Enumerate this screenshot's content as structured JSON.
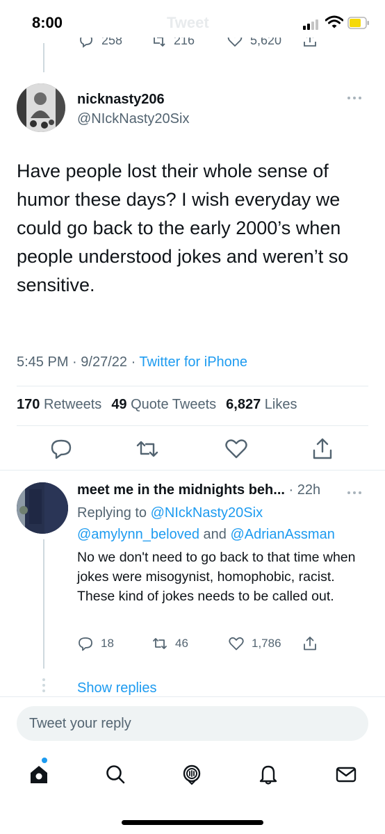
{
  "status_bar": {
    "time": "8:00",
    "faded_title": "Tweet"
  },
  "previous_tweet": {
    "replies": "258",
    "retweets": "216",
    "likes": "5,620"
  },
  "main_tweet": {
    "display_name": "nicknasty206",
    "handle": "@NIckNasty20Six",
    "text": "Have people lost their whole sense of humor these days?  I wish everyday we could go back to the early 2000’s when people understood jokes and weren’t so sensitive.",
    "time": "5:45 PM",
    "date": "9/27/22",
    "source": "Twitter for iPhone",
    "retweets_count": "170",
    "retweets_label": "Retweets",
    "quotes_count": "49",
    "quotes_label": "Quote Tweets",
    "likes_count": "6,827",
    "likes_label": "Likes"
  },
  "reply_tweet": {
    "display_name": "meet me in the midnights beh...",
    "time": "22h",
    "replying_to_label": "Replying to",
    "mention_1": "@NIckNasty20Six",
    "mention_2": "@amylynn_beloved",
    "and_label": "and",
    "mention_3": "@AdrianAssman",
    "text": "No we don't need to go back to that time when jokes were misogynist, homophobic, racist. These kind of jokes needs to be called out.",
    "reply_count": "18",
    "retweet_count": "46",
    "like_count": "1,786",
    "show_replies": "Show replies"
  },
  "composer": {
    "placeholder": "Tweet your reply"
  },
  "colors": {
    "accent": "#1d9bf0",
    "text": "#0f1419",
    "muted": "#536471",
    "divider": "#e6ecf0"
  },
  "tab_bar": {
    "icons": [
      "home-icon",
      "search-icon",
      "spaces-icon",
      "notifications-icon",
      "messages-icon"
    ]
  }
}
